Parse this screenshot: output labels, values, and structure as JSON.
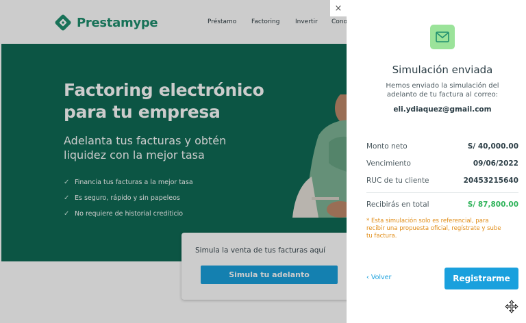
{
  "brand": {
    "name": "Prestamype",
    "color": "#1f8f6e"
  },
  "nav": {
    "items": [
      "Préstamo",
      "Factoring",
      "Invertir",
      "Cono"
    ]
  },
  "hero": {
    "title_line1": "Factoring electrónico",
    "title_line2": "para tu empresa",
    "subtitle_line1": "Adelanta tus facturas y obtén",
    "subtitle_line2": "liquidez con la mejor tasa",
    "features": [
      "Financia tus facturas a la mejor tasa",
      "Es seguro, rápido y sin papeleos",
      "No requiere de historial crediticio"
    ],
    "bg_color": "#0f6b55"
  },
  "sim_card": {
    "title": "Simula la venta de tus facturas aquí",
    "button_label": "Simula tu adelanto"
  },
  "modal": {
    "close_label": "×",
    "icon": "mail-icon",
    "title": "Simulación enviada",
    "desc_line1": "Hemos enviado la simulación del",
    "desc_line2": "adelanto de tu factura al correo:",
    "email": "eli.ydiaquez@gmail.com",
    "rows": [
      {
        "label": "Monto neto",
        "value": "S/ 40,000.00"
      },
      {
        "label": "Vencimiento",
        "value": "09/06/2022"
      },
      {
        "label": "RUC de tu cliente",
        "value": "20453215640"
      }
    ],
    "total": {
      "label": "Recibirás en total",
      "value": "S/ 87,800.00"
    },
    "note_line1": "* Esta simulación solo es referencial, para",
    "note_line2": "recibir una propuesta oficial, regístrate y sube",
    "note_line3": "tu factura.",
    "back_label": "Volver",
    "register_label": "Registrarme"
  },
  "colors": {
    "accent_blue": "#1aa0dd",
    "success_green": "#2fb35a",
    "warning_orange": "#e08b14",
    "mail_icon_bg": "#9be39a"
  }
}
